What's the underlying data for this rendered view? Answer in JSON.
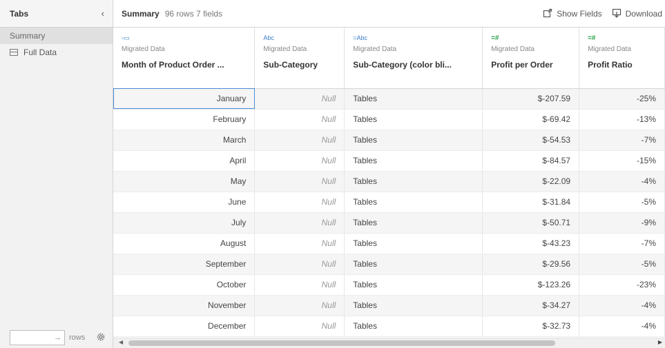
{
  "left_panel": {
    "title": "Tabs",
    "collapse_icon": "‹",
    "tabs": [
      {
        "label": "Summary",
        "active": true
      },
      {
        "label": "Full Data",
        "active": false
      }
    ],
    "footer": {
      "rows_arrow": "→",
      "rows_label": "rows"
    }
  },
  "toolbar": {
    "title": "Summary",
    "meta": "96 rows  7 fields",
    "show_fields": "Show Fields",
    "download": "Download"
  },
  "table": {
    "columns": [
      {
        "type_icon": "date-icon",
        "type_text": "▫▭",
        "source": "Migrated Data",
        "name": "Month of Product Order ..."
      },
      {
        "type_icon": "string-icon",
        "type_text": "Abc",
        "source": "Migrated Data",
        "name": "Sub-Category"
      },
      {
        "type_icon": "string-icon",
        "type_text": "=Abc",
        "source": "Migrated Data",
        "name": "Sub-Category (color bli..."
      },
      {
        "type_icon": "number-icon",
        "type_text": "=#",
        "source": "Migrated Data",
        "name": "Profit per Order"
      },
      {
        "type_icon": "number-icon",
        "type_text": "=#",
        "source": "Migrated Data",
        "name": "Profit Ratio"
      }
    ],
    "rows": [
      [
        "January",
        "Null",
        "Tables",
        "$-207.59",
        "-25%"
      ],
      [
        "February",
        "Null",
        "Tables",
        "$-69.42",
        "-13%"
      ],
      [
        "March",
        "Null",
        "Tables",
        "$-54.53",
        "-7%"
      ],
      [
        "April",
        "Null",
        "Tables",
        "$-84.57",
        "-15%"
      ],
      [
        "May",
        "Null",
        "Tables",
        "$-22.09",
        "-4%"
      ],
      [
        "June",
        "Null",
        "Tables",
        "$-31.84",
        "-5%"
      ],
      [
        "July",
        "Null",
        "Tables",
        "$-50.71",
        "-9%"
      ],
      [
        "August",
        "Null",
        "Tables",
        "$-43.23",
        "-7%"
      ],
      [
        "September",
        "Null",
        "Tables",
        "$-29.56",
        "-5%"
      ],
      [
        "October",
        "Null",
        "Tables",
        "$-123.26",
        "-23%"
      ],
      [
        "November",
        "Null",
        "Tables",
        "$-34.27",
        "-4%"
      ],
      [
        "December",
        "Null",
        "Tables",
        "$-32.73",
        "-4%"
      ]
    ]
  },
  "colors": {
    "selection_border": "#4a8ad4",
    "type_blue": "#3a7dc9",
    "type_green": "#2aa04a"
  }
}
